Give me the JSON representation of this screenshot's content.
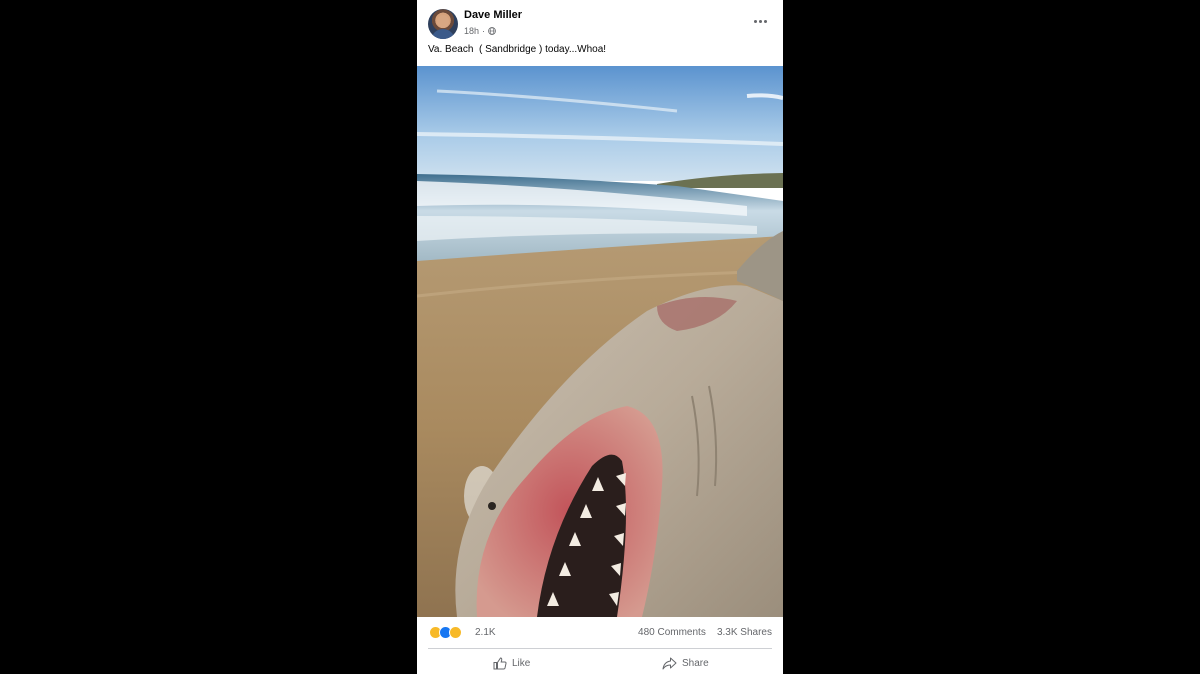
{
  "post": {
    "author": "Dave Miller",
    "time": "18h",
    "separator": "·",
    "privacy_icon": "globe-icon",
    "text": "Va. Beach  ( Sandbridge ) today...Whoa!",
    "image": "dead shark lying on sandy beach with open mouth and teeth, ocean waves in background",
    "reactions": {
      "icons": [
        "wow-icon",
        "like-icon",
        "sad-icon"
      ],
      "count": "2.1K"
    },
    "comments": "480 Comments",
    "shares": "3.3K Shares",
    "actions": {
      "like": "Like",
      "share": "Share"
    }
  },
  "colors": {
    "background": "#000000",
    "card": "#ffffff",
    "text_primary": "#050505",
    "text_secondary": "#65676b",
    "like_blue": "#1877f2",
    "reaction_yellow": "#f7b928"
  }
}
